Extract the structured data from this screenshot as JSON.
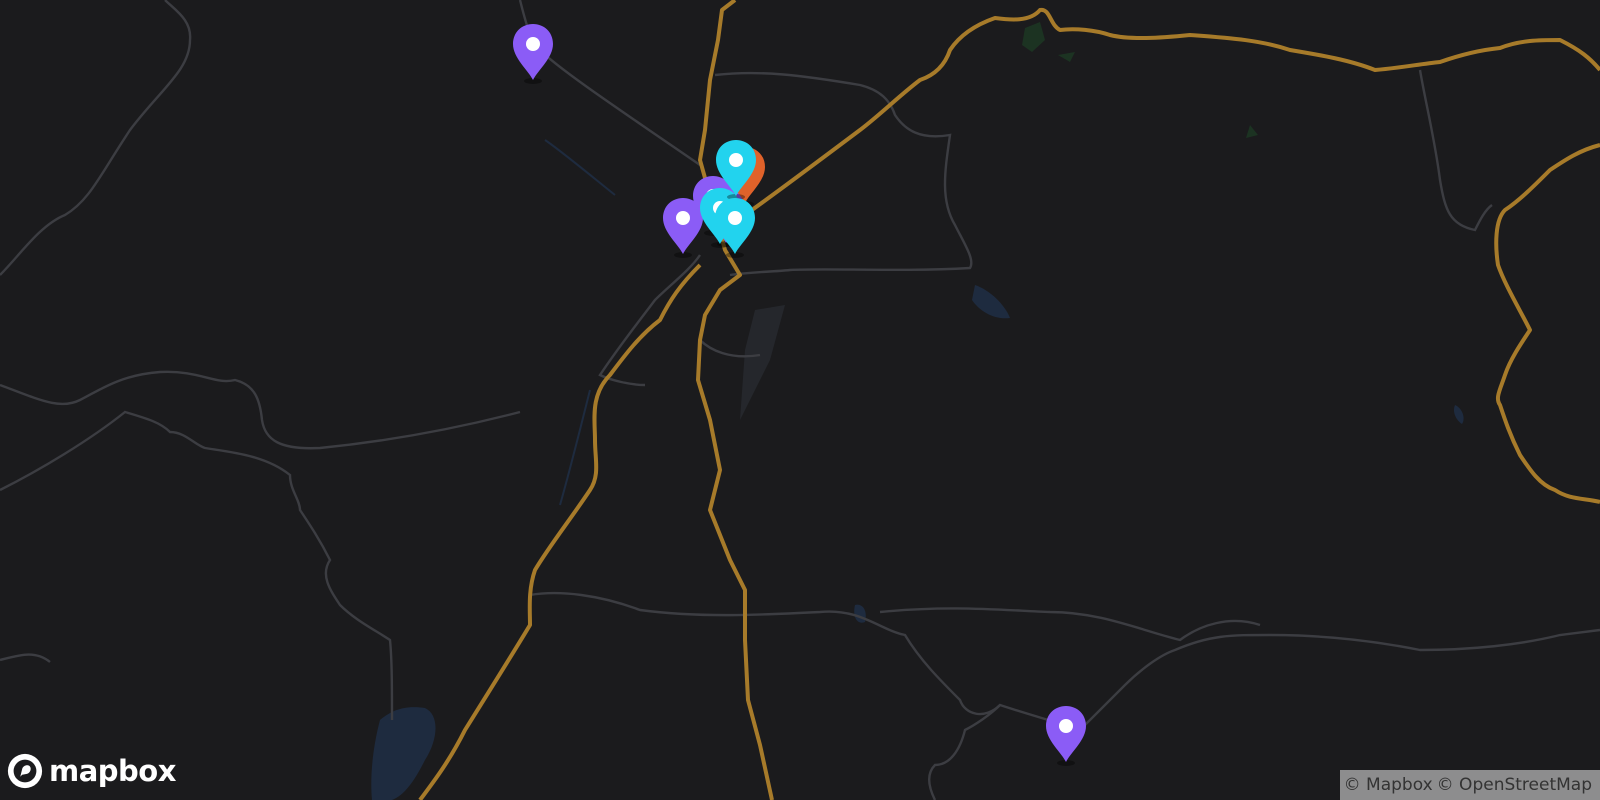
{
  "map": {
    "colors": {
      "background": "#1b1b1d",
      "road_major": "#a77b2a",
      "road_minor": "#3c3d42",
      "water": "#1e2b3f",
      "park": "#1c3322",
      "marker_purple": "#8b5cf6",
      "marker_cyan": "#22d3ee",
      "marker_orange": "#e0622a"
    },
    "markers": [
      {
        "name": "marker-purple-1",
        "color": "purple"
      },
      {
        "name": "marker-purple-2",
        "color": "purple"
      },
      {
        "name": "marker-purple-3",
        "color": "purple"
      },
      {
        "name": "marker-purple-4",
        "color": "purple"
      },
      {
        "name": "marker-purple-5",
        "color": "purple"
      },
      {
        "name": "marker-orange-1",
        "color": "orange"
      },
      {
        "name": "marker-cyan-1",
        "color": "cyan"
      },
      {
        "name": "marker-cyan-2",
        "color": "cyan"
      },
      {
        "name": "marker-cyan-3",
        "color": "cyan"
      }
    ]
  },
  "branding": {
    "logo_icon": "mapbox-logo-icon",
    "logo_text": "mapbox"
  },
  "attribution": {
    "items": [
      "© Mapbox",
      "© OpenStreetMap"
    ]
  }
}
